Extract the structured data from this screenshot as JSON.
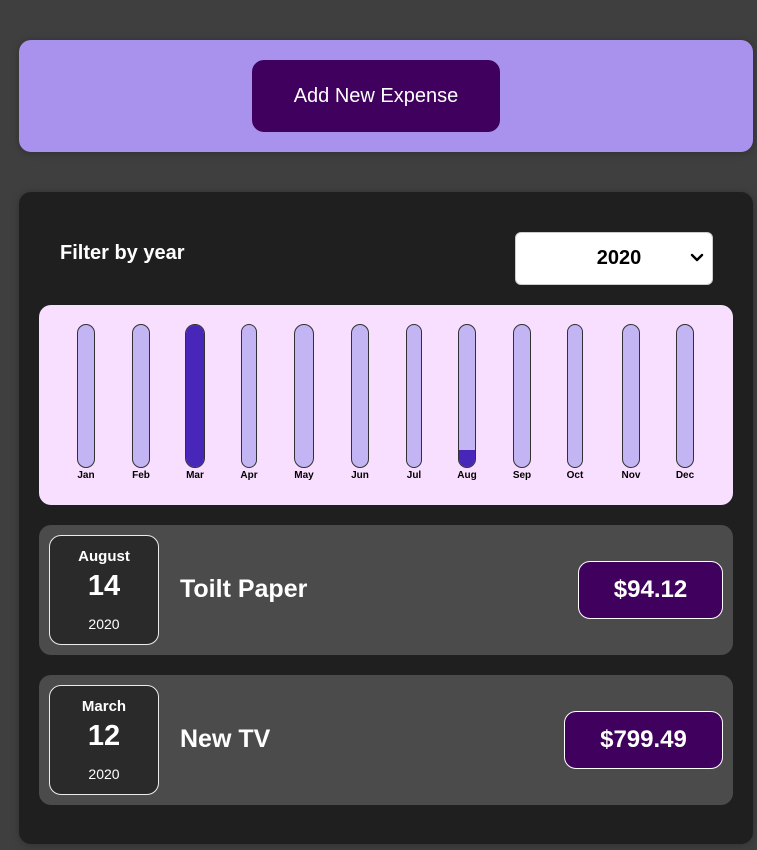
{
  "new_expense": {
    "button_label": "Add New Expense"
  },
  "filter": {
    "label": "Filter by year",
    "selected_year": "2020"
  },
  "chart_data": {
    "type": "bar",
    "categories": [
      "Jan",
      "Feb",
      "Mar",
      "Apr",
      "May",
      "Jun",
      "Jul",
      "Aug",
      "Sep",
      "Oct",
      "Nov",
      "Dec"
    ],
    "values": [
      0,
      0,
      799.49,
      0,
      0,
      0,
      0,
      94.12,
      0,
      0,
      0,
      0
    ],
    "ylim": [
      0,
      799.49
    ],
    "grid": false,
    "colors": {
      "track": "#c3b4f3",
      "fill": "#4826b9",
      "background": "#f8dfff"
    }
  },
  "expenses": [
    {
      "month": "August",
      "day": "14",
      "year": "2020",
      "title": "Toilt Paper",
      "amount": "$94.12"
    },
    {
      "month": "March",
      "day": "12",
      "year": "2020",
      "title": "New TV",
      "amount": "$799.49"
    }
  ],
  "colors": {
    "page_bg": "#3f3f3f",
    "new_expense_bg": "#a892ee",
    "button_bg": "#40005d",
    "panel_bg": "#1f1f1f",
    "item_bg": "#4b4b4b"
  }
}
